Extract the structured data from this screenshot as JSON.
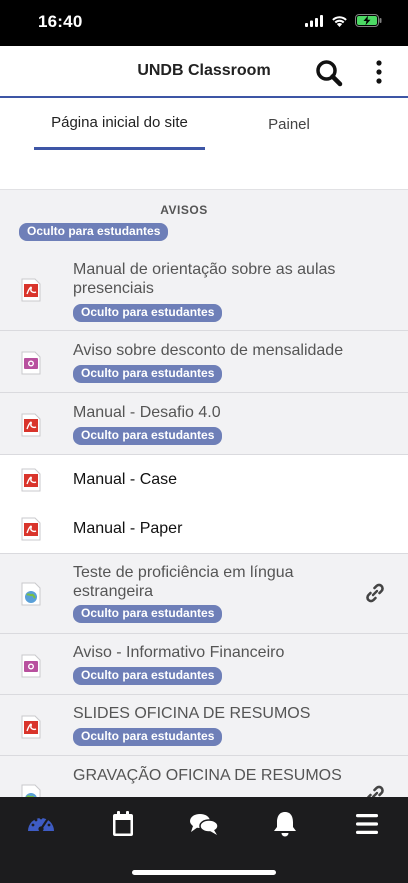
{
  "status_bar": {
    "time": "16:40"
  },
  "header": {
    "title": "UNDB Classroom"
  },
  "tabs": [
    {
      "label": "Página inicial do site"
    },
    {
      "label": "Painel"
    }
  ],
  "section": {
    "title": "AVISOS",
    "badge": "Oculto para estudantes"
  },
  "items": [
    {
      "name": "Manual de orientação sobre as aulas presenciais",
      "icon": "pdf-icon",
      "badge": "Oculto para estudantes"
    },
    {
      "name": "Aviso sobre desconto de mensalidade",
      "icon": "image-file-icon",
      "badge": "Oculto para estudantes"
    },
    {
      "name": "Manual - Desafio 4.0",
      "icon": "pdf-icon",
      "badge": "Oculto para estudantes"
    },
    {
      "name": "Manual - Case",
      "icon": "pdf-icon"
    },
    {
      "name": "Manual - Paper",
      "icon": "pdf-icon"
    },
    {
      "name": "Teste de proficiência em língua estrangeira",
      "icon": "web-link-icon",
      "badge": "Oculto para estudantes",
      "has_link": true
    },
    {
      "name": "Aviso - Informativo Financeiro",
      "icon": "image-file-icon",
      "badge": "Oculto para estudantes"
    },
    {
      "name": "SLIDES OFICINA DE RESUMOS",
      "icon": "pdf-icon",
      "badge": "Oculto para estudantes"
    },
    {
      "name": "GRAVAÇÃO OFICINA DE RESUMOS",
      "icon": "web-link-icon",
      "has_link": true
    }
  ],
  "bottom_nav": [
    "dashboard-icon",
    "calendar-icon",
    "messages-icon",
    "notifications-icon",
    "menu-icon"
  ],
  "colors": {
    "accent": "#3e56a6",
    "badge": "#6e7fb8",
    "nav_bg": "#1c1c1e"
  }
}
